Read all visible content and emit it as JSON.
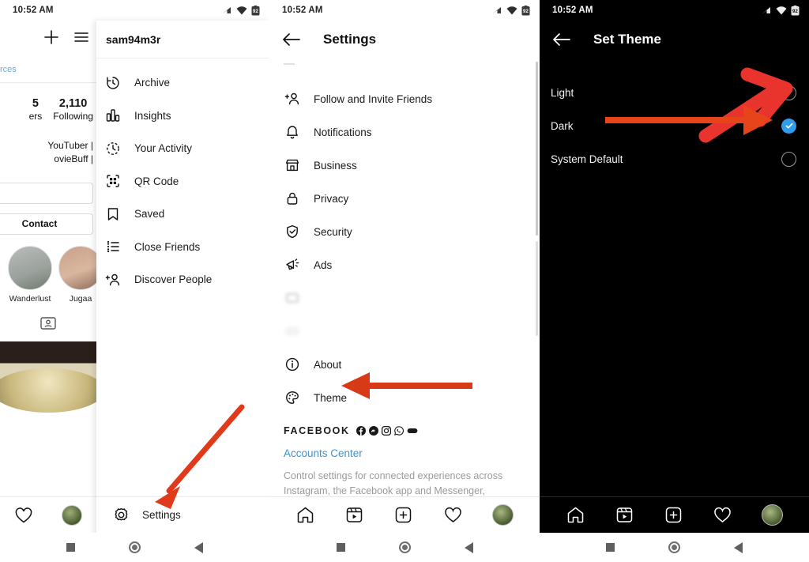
{
  "status_bar": {
    "time": "10:52 AM",
    "battery_label": "92",
    "icons": [
      "signal-icon",
      "wifi-icon",
      "battery-icon"
    ]
  },
  "panel1": {
    "profile": {
      "link_text": "rces",
      "stats": [
        {
          "value": "5",
          "label": "ers"
        },
        {
          "value": "2,110",
          "label": "Following"
        }
      ],
      "bio_line1": "YouTuber |",
      "bio_line2": "ovieBuff |",
      "contact_button": "Contact",
      "highlights": [
        {
          "label": "Wanderlust"
        },
        {
          "label": "Jugaa"
        }
      ]
    },
    "drawer": {
      "username": "sam94m3r",
      "items": [
        {
          "label": "Archive",
          "icon": "archive-clock-icon"
        },
        {
          "label": "Insights",
          "icon": "insights-bars-icon"
        },
        {
          "label": "Your Activity",
          "icon": "activity-clock-icon"
        },
        {
          "label": "QR Code",
          "icon": "qr-code-icon"
        },
        {
          "label": "Saved",
          "icon": "bookmark-icon"
        },
        {
          "label": "Close Friends",
          "icon": "close-friends-list-icon"
        },
        {
          "label": "Discover People",
          "icon": "add-person-icon"
        }
      ],
      "footer": {
        "label": "Settings",
        "icon": "gear-icon"
      }
    }
  },
  "panel2": {
    "title": "Settings",
    "back_icon": "back-arrow-icon",
    "items": [
      {
        "label": "Follow and Invite Friends",
        "icon": "add-person-icon",
        "blurred": false
      },
      {
        "label": "Notifications",
        "icon": "bell-icon",
        "blurred": false
      },
      {
        "label": "Business",
        "icon": "store-icon",
        "blurred": false
      },
      {
        "label": "Privacy",
        "icon": "lock-icon",
        "blurred": false
      },
      {
        "label": "Security",
        "icon": "shield-check-icon",
        "blurred": false
      },
      {
        "label": "Ads",
        "icon": "megaphone-icon",
        "blurred": false
      },
      {
        "label": "",
        "icon": "hidden-icon",
        "blurred": true
      },
      {
        "label": "",
        "icon": "hidden-icon",
        "blurred": true
      },
      {
        "label": "About",
        "icon": "info-circle-icon",
        "blurred": false
      },
      {
        "label": "Theme",
        "icon": "palette-icon",
        "blurred": false
      }
    ],
    "facebook": {
      "heading": "FACEBOOK",
      "brand_icons": [
        "facebook-icon",
        "messenger-icon",
        "instagram-icon",
        "whatsapp-icon",
        "oculus-icon"
      ],
      "link": "Accounts Center",
      "description": "Control settings for connected experiences across Instagram, the Facebook app and Messenger, including"
    }
  },
  "panel3": {
    "title": "Set Theme",
    "back_icon": "back-arrow-icon",
    "selected": "Dark",
    "accent_color": "#2f9ced",
    "options": [
      {
        "label": "Light",
        "selected": false
      },
      {
        "label": "Dark",
        "selected": true
      },
      {
        "label": "System Default",
        "selected": false
      }
    ]
  },
  "bottom_nav": {
    "items": [
      {
        "name": "home-icon"
      },
      {
        "name": "reels-icon"
      },
      {
        "name": "create-post-icon"
      },
      {
        "name": "heart-activity-icon"
      },
      {
        "name": "profile-avatar"
      }
    ]
  },
  "android_nav": {
    "items": [
      "recents-square-icon",
      "home-circle-icon",
      "back-triangle-icon"
    ]
  },
  "annotations": {
    "color": "#e03a1a",
    "arrows": [
      {
        "name": "arrow-to-settings",
        "points_to": "Settings"
      },
      {
        "name": "arrow-to-theme",
        "points_to": "Theme"
      },
      {
        "name": "arrow-to-light-option",
        "points_to": "Light radio"
      },
      {
        "name": "arrow-to-dark-option",
        "points_to": "Dark radio"
      }
    ]
  }
}
